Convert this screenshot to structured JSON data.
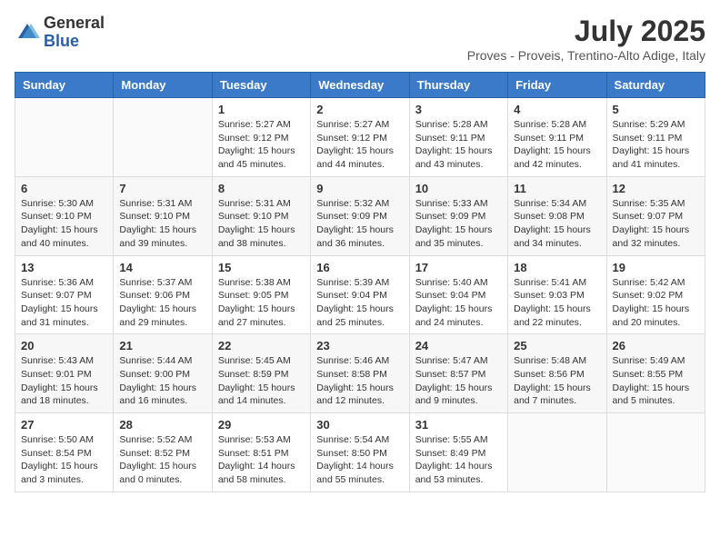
{
  "logo": {
    "general": "General",
    "blue": "Blue"
  },
  "header": {
    "month_year": "July 2025",
    "location": "Proves - Proveis, Trentino-Alto Adige, Italy"
  },
  "weekdays": [
    "Sunday",
    "Monday",
    "Tuesday",
    "Wednesday",
    "Thursday",
    "Friday",
    "Saturday"
  ],
  "weeks": [
    [
      {
        "day": "",
        "info": ""
      },
      {
        "day": "",
        "info": ""
      },
      {
        "day": "1",
        "info": "Sunrise: 5:27 AM\nSunset: 9:12 PM\nDaylight: 15 hours and 45 minutes."
      },
      {
        "day": "2",
        "info": "Sunrise: 5:27 AM\nSunset: 9:12 PM\nDaylight: 15 hours and 44 minutes."
      },
      {
        "day": "3",
        "info": "Sunrise: 5:28 AM\nSunset: 9:11 PM\nDaylight: 15 hours and 43 minutes."
      },
      {
        "day": "4",
        "info": "Sunrise: 5:28 AM\nSunset: 9:11 PM\nDaylight: 15 hours and 42 minutes."
      },
      {
        "day": "5",
        "info": "Sunrise: 5:29 AM\nSunset: 9:11 PM\nDaylight: 15 hours and 41 minutes."
      }
    ],
    [
      {
        "day": "6",
        "info": "Sunrise: 5:30 AM\nSunset: 9:10 PM\nDaylight: 15 hours and 40 minutes."
      },
      {
        "day": "7",
        "info": "Sunrise: 5:31 AM\nSunset: 9:10 PM\nDaylight: 15 hours and 39 minutes."
      },
      {
        "day": "8",
        "info": "Sunrise: 5:31 AM\nSunset: 9:10 PM\nDaylight: 15 hours and 38 minutes."
      },
      {
        "day": "9",
        "info": "Sunrise: 5:32 AM\nSunset: 9:09 PM\nDaylight: 15 hours and 36 minutes."
      },
      {
        "day": "10",
        "info": "Sunrise: 5:33 AM\nSunset: 9:09 PM\nDaylight: 15 hours and 35 minutes."
      },
      {
        "day": "11",
        "info": "Sunrise: 5:34 AM\nSunset: 9:08 PM\nDaylight: 15 hours and 34 minutes."
      },
      {
        "day": "12",
        "info": "Sunrise: 5:35 AM\nSunset: 9:07 PM\nDaylight: 15 hours and 32 minutes."
      }
    ],
    [
      {
        "day": "13",
        "info": "Sunrise: 5:36 AM\nSunset: 9:07 PM\nDaylight: 15 hours and 31 minutes."
      },
      {
        "day": "14",
        "info": "Sunrise: 5:37 AM\nSunset: 9:06 PM\nDaylight: 15 hours and 29 minutes."
      },
      {
        "day": "15",
        "info": "Sunrise: 5:38 AM\nSunset: 9:05 PM\nDaylight: 15 hours and 27 minutes."
      },
      {
        "day": "16",
        "info": "Sunrise: 5:39 AM\nSunset: 9:04 PM\nDaylight: 15 hours and 25 minutes."
      },
      {
        "day": "17",
        "info": "Sunrise: 5:40 AM\nSunset: 9:04 PM\nDaylight: 15 hours and 24 minutes."
      },
      {
        "day": "18",
        "info": "Sunrise: 5:41 AM\nSunset: 9:03 PM\nDaylight: 15 hours and 22 minutes."
      },
      {
        "day": "19",
        "info": "Sunrise: 5:42 AM\nSunset: 9:02 PM\nDaylight: 15 hours and 20 minutes."
      }
    ],
    [
      {
        "day": "20",
        "info": "Sunrise: 5:43 AM\nSunset: 9:01 PM\nDaylight: 15 hours and 18 minutes."
      },
      {
        "day": "21",
        "info": "Sunrise: 5:44 AM\nSunset: 9:00 PM\nDaylight: 15 hours and 16 minutes."
      },
      {
        "day": "22",
        "info": "Sunrise: 5:45 AM\nSunset: 8:59 PM\nDaylight: 15 hours and 14 minutes."
      },
      {
        "day": "23",
        "info": "Sunrise: 5:46 AM\nSunset: 8:58 PM\nDaylight: 15 hours and 12 minutes."
      },
      {
        "day": "24",
        "info": "Sunrise: 5:47 AM\nSunset: 8:57 PM\nDaylight: 15 hours and 9 minutes."
      },
      {
        "day": "25",
        "info": "Sunrise: 5:48 AM\nSunset: 8:56 PM\nDaylight: 15 hours and 7 minutes."
      },
      {
        "day": "26",
        "info": "Sunrise: 5:49 AM\nSunset: 8:55 PM\nDaylight: 15 hours and 5 minutes."
      }
    ],
    [
      {
        "day": "27",
        "info": "Sunrise: 5:50 AM\nSunset: 8:54 PM\nDaylight: 15 hours and 3 minutes."
      },
      {
        "day": "28",
        "info": "Sunrise: 5:52 AM\nSunset: 8:52 PM\nDaylight: 15 hours and 0 minutes."
      },
      {
        "day": "29",
        "info": "Sunrise: 5:53 AM\nSunset: 8:51 PM\nDaylight: 14 hours and 58 minutes."
      },
      {
        "day": "30",
        "info": "Sunrise: 5:54 AM\nSunset: 8:50 PM\nDaylight: 14 hours and 55 minutes."
      },
      {
        "day": "31",
        "info": "Sunrise: 5:55 AM\nSunset: 8:49 PM\nDaylight: 14 hours and 53 minutes."
      },
      {
        "day": "",
        "info": ""
      },
      {
        "day": "",
        "info": ""
      }
    ]
  ]
}
